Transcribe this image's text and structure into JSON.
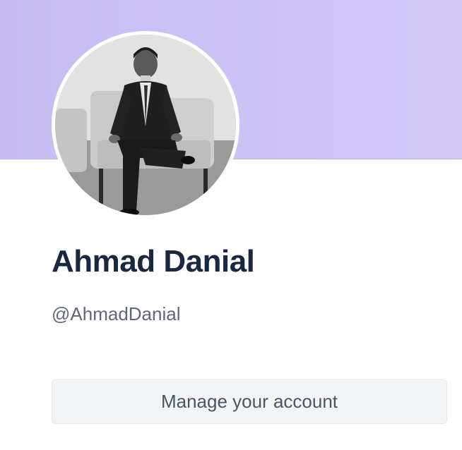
{
  "profile": {
    "name": "Ahmad Danial",
    "handle": "@AhmadDanial",
    "avatar_icon": "profile-photo",
    "manage_label": "Manage your account"
  },
  "colors": {
    "banner": "#c9bff4",
    "name_text": "#1a2740",
    "handle_text": "#5e6878",
    "button_bg": "#f3f4f6",
    "button_text": "#4a5568"
  }
}
